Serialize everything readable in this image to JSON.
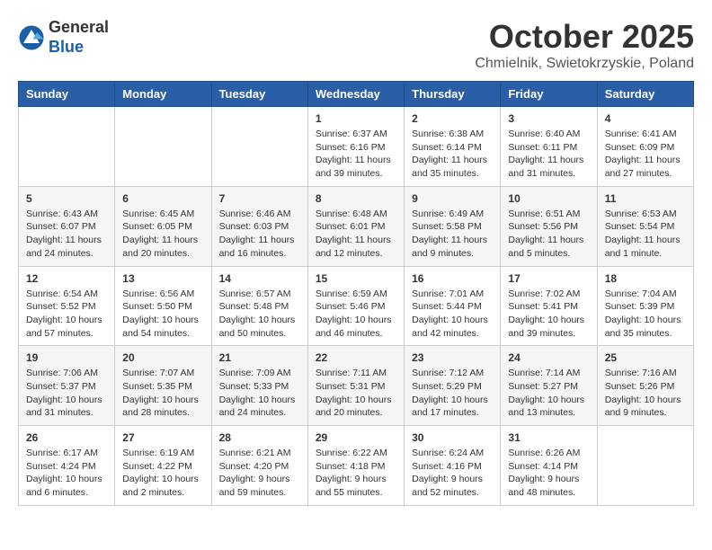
{
  "header": {
    "logo_general": "General",
    "logo_blue": "Blue",
    "month": "October 2025",
    "location": "Chmielnik, Swietokrzyskie, Poland"
  },
  "weekdays": [
    "Sunday",
    "Monday",
    "Tuesday",
    "Wednesday",
    "Thursday",
    "Friday",
    "Saturday"
  ],
  "weeks": [
    [
      {
        "day": "",
        "info": ""
      },
      {
        "day": "",
        "info": ""
      },
      {
        "day": "",
        "info": ""
      },
      {
        "day": "1",
        "info": "Sunrise: 6:37 AM\nSunset: 6:16 PM\nDaylight: 11 hours\nand 39 minutes."
      },
      {
        "day": "2",
        "info": "Sunrise: 6:38 AM\nSunset: 6:14 PM\nDaylight: 11 hours\nand 35 minutes."
      },
      {
        "day": "3",
        "info": "Sunrise: 6:40 AM\nSunset: 6:11 PM\nDaylight: 11 hours\nand 31 minutes."
      },
      {
        "day": "4",
        "info": "Sunrise: 6:41 AM\nSunset: 6:09 PM\nDaylight: 11 hours\nand 27 minutes."
      }
    ],
    [
      {
        "day": "5",
        "info": "Sunrise: 6:43 AM\nSunset: 6:07 PM\nDaylight: 11 hours\nand 24 minutes."
      },
      {
        "day": "6",
        "info": "Sunrise: 6:45 AM\nSunset: 6:05 PM\nDaylight: 11 hours\nand 20 minutes."
      },
      {
        "day": "7",
        "info": "Sunrise: 6:46 AM\nSunset: 6:03 PM\nDaylight: 11 hours\nand 16 minutes."
      },
      {
        "day": "8",
        "info": "Sunrise: 6:48 AM\nSunset: 6:01 PM\nDaylight: 11 hours\nand 12 minutes."
      },
      {
        "day": "9",
        "info": "Sunrise: 6:49 AM\nSunset: 5:58 PM\nDaylight: 11 hours\nand 9 minutes."
      },
      {
        "day": "10",
        "info": "Sunrise: 6:51 AM\nSunset: 5:56 PM\nDaylight: 11 hours\nand 5 minutes."
      },
      {
        "day": "11",
        "info": "Sunrise: 6:53 AM\nSunset: 5:54 PM\nDaylight: 11 hours\nand 1 minute."
      }
    ],
    [
      {
        "day": "12",
        "info": "Sunrise: 6:54 AM\nSunset: 5:52 PM\nDaylight: 10 hours\nand 57 minutes."
      },
      {
        "day": "13",
        "info": "Sunrise: 6:56 AM\nSunset: 5:50 PM\nDaylight: 10 hours\nand 54 minutes."
      },
      {
        "day": "14",
        "info": "Sunrise: 6:57 AM\nSunset: 5:48 PM\nDaylight: 10 hours\nand 50 minutes."
      },
      {
        "day": "15",
        "info": "Sunrise: 6:59 AM\nSunset: 5:46 PM\nDaylight: 10 hours\nand 46 minutes."
      },
      {
        "day": "16",
        "info": "Sunrise: 7:01 AM\nSunset: 5:44 PM\nDaylight: 10 hours\nand 42 minutes."
      },
      {
        "day": "17",
        "info": "Sunrise: 7:02 AM\nSunset: 5:41 PM\nDaylight: 10 hours\nand 39 minutes."
      },
      {
        "day": "18",
        "info": "Sunrise: 7:04 AM\nSunset: 5:39 PM\nDaylight: 10 hours\nand 35 minutes."
      }
    ],
    [
      {
        "day": "19",
        "info": "Sunrise: 7:06 AM\nSunset: 5:37 PM\nDaylight: 10 hours\nand 31 minutes."
      },
      {
        "day": "20",
        "info": "Sunrise: 7:07 AM\nSunset: 5:35 PM\nDaylight: 10 hours\nand 28 minutes."
      },
      {
        "day": "21",
        "info": "Sunrise: 7:09 AM\nSunset: 5:33 PM\nDaylight: 10 hours\nand 24 minutes."
      },
      {
        "day": "22",
        "info": "Sunrise: 7:11 AM\nSunset: 5:31 PM\nDaylight: 10 hours\nand 20 minutes."
      },
      {
        "day": "23",
        "info": "Sunrise: 7:12 AM\nSunset: 5:29 PM\nDaylight: 10 hours\nand 17 minutes."
      },
      {
        "day": "24",
        "info": "Sunrise: 7:14 AM\nSunset: 5:27 PM\nDaylight: 10 hours\nand 13 minutes."
      },
      {
        "day": "25",
        "info": "Sunrise: 7:16 AM\nSunset: 5:26 PM\nDaylight: 10 hours\nand 9 minutes."
      }
    ],
    [
      {
        "day": "26",
        "info": "Sunrise: 6:17 AM\nSunset: 4:24 PM\nDaylight: 10 hours\nand 6 minutes."
      },
      {
        "day": "27",
        "info": "Sunrise: 6:19 AM\nSunset: 4:22 PM\nDaylight: 10 hours\nand 2 minutes."
      },
      {
        "day": "28",
        "info": "Sunrise: 6:21 AM\nSunset: 4:20 PM\nDaylight: 9 hours\nand 59 minutes."
      },
      {
        "day": "29",
        "info": "Sunrise: 6:22 AM\nSunset: 4:18 PM\nDaylight: 9 hours\nand 55 minutes."
      },
      {
        "day": "30",
        "info": "Sunrise: 6:24 AM\nSunset: 4:16 PM\nDaylight: 9 hours\nand 52 minutes."
      },
      {
        "day": "31",
        "info": "Sunrise: 6:26 AM\nSunset: 4:14 PM\nDaylight: 9 hours\nand 48 minutes."
      },
      {
        "day": "",
        "info": ""
      }
    ]
  ]
}
